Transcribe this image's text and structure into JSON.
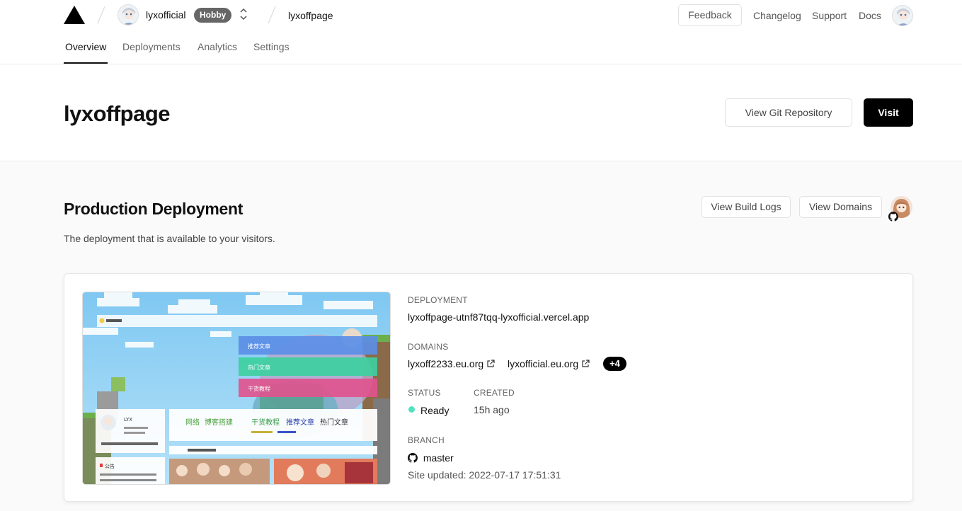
{
  "header": {
    "team_name": "lyxofficial",
    "plan_badge": "Hobby",
    "project_name": "lyxoffpage",
    "feedback_label": "Feedback",
    "links": [
      "Changelog",
      "Support",
      "Docs"
    ]
  },
  "tabs": [
    "Overview",
    "Deployments",
    "Analytics",
    "Settings"
  ],
  "active_tab": "Overview",
  "title_band": {
    "title": "lyxoffpage",
    "git_button": "View Git Repository",
    "visit_button": "Visit"
  },
  "production": {
    "title": "Production Deployment",
    "subtitle": "The deployment that is available to your visitors.",
    "build_logs_button": "View Build Logs",
    "domains_button": "View Domains"
  },
  "card": {
    "deployment_label": "DEPLOYMENT",
    "deployment_url": "lyxoffpage-utnf87tqq-lyxofficial.vercel.app",
    "domains_label": "DOMAINS",
    "domains": [
      "lyxoff2233.eu.org",
      "lyxofficial.eu.org"
    ],
    "more_domains": "+4",
    "status_label": "STATUS",
    "status_value": "Ready",
    "created_label": "CREATED",
    "created_value": "15h ago",
    "branch_label": "BRANCH",
    "branch_value": "master",
    "site_updated": "Site updated: 2022-07-17 17:51:31"
  },
  "preview": {
    "menu_items": [
      "推荐文章",
      "热门文章",
      "干货教程"
    ],
    "nav_words": [
      "网络",
      "博客搭建",
      "干货教程",
      "推荐文章",
      "热门文章"
    ],
    "author": "LYX",
    "notice": "公告"
  },
  "colors": {
    "ready": "#50e3c2",
    "accent": "#000000"
  }
}
